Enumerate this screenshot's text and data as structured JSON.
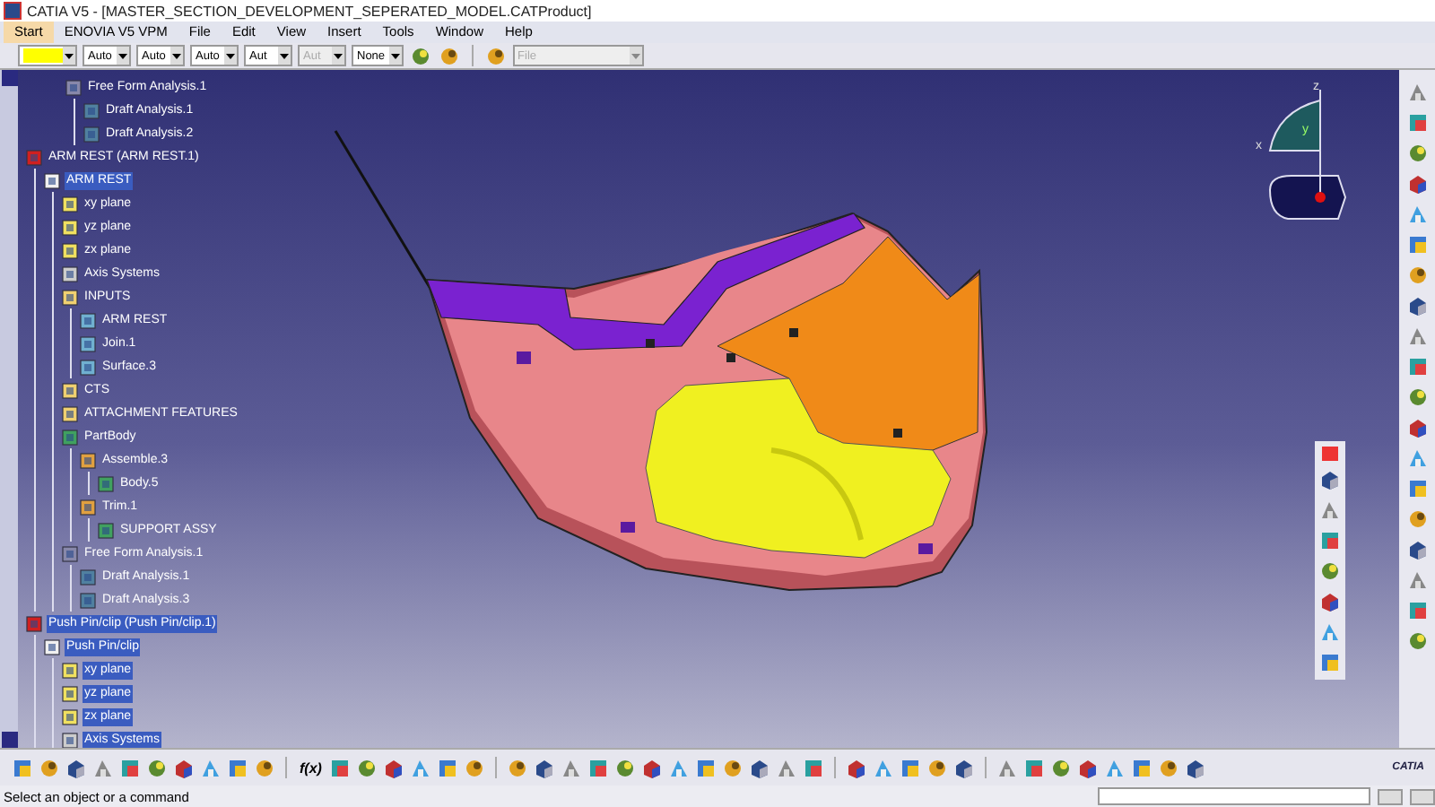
{
  "window": {
    "title": "CATIA V5 - [MASTER_SECTION_DEVELOPMENT_SEPERATED_MODEL.CATProduct]"
  },
  "menu": [
    {
      "label": "Start",
      "selected": true
    },
    {
      "label": "ENOVIA V5 VPM",
      "selected": false
    },
    {
      "label": "File",
      "selected": false
    },
    {
      "label": "Edit",
      "selected": false
    },
    {
      "label": "View",
      "selected": false
    },
    {
      "label": "Insert",
      "selected": false
    },
    {
      "label": "Tools",
      "selected": false
    },
    {
      "label": "Window",
      "selected": false
    },
    {
      "label": "Help",
      "selected": false
    }
  ],
  "format_toolbar": [
    {
      "kind": "color",
      "color": "#ffff00",
      "disabled": false
    },
    {
      "kind": "dropdown",
      "value": "Auto",
      "disabled": false
    },
    {
      "kind": "dropdown",
      "value": "Auto",
      "disabled": false
    },
    {
      "kind": "dropdown",
      "value": "Auto",
      "disabled": false
    },
    {
      "kind": "dropdown",
      "value": "Aut",
      "disabled": false
    },
    {
      "kind": "dropdown",
      "value": "Aut",
      "disabled": true
    },
    {
      "kind": "dropdown",
      "value": "None",
      "disabled": false
    }
  ],
  "file_toolbar": {
    "value": "File",
    "disabled": true
  },
  "tree": {
    "continued": [
      {
        "label": "Free Form Analysis.1",
        "kind": "analysis",
        "selected": false,
        "children": [
          {
            "label": "Draft Analysis.1",
            "kind": "draft",
            "selected": false
          },
          {
            "label": "Draft Analysis.2",
            "kind": "draft",
            "selected": false
          }
        ]
      }
    ],
    "items": [
      {
        "label": "ARM REST (ARM REST.1)",
        "kind": "product",
        "selected": false,
        "children": [
          {
            "label": "ARM REST",
            "kind": "part",
            "selected": true,
            "children": [
              {
                "label": "xy plane",
                "kind": "plane",
                "selected": false
              },
              {
                "label": "yz plane",
                "kind": "plane",
                "selected": false
              },
              {
                "label": "zx plane",
                "kind": "plane",
                "selected": false
              },
              {
                "label": "Axis Systems",
                "kind": "axis",
                "selected": false
              },
              {
                "label": "INPUTS",
                "kind": "geoset",
                "selected": false,
                "children": [
                  {
                    "label": "ARM REST",
                    "kind": "surface",
                    "selected": false
                  },
                  {
                    "label": "Join.1",
                    "kind": "surface",
                    "selected": false
                  },
                  {
                    "label": "Surface.3",
                    "kind": "surface",
                    "selected": false
                  }
                ]
              },
              {
                "label": "CTS",
                "kind": "geoset",
                "selected": false
              },
              {
                "label": "ATTACHMENT FEATURES",
                "kind": "geoset",
                "selected": false
              },
              {
                "label": "PartBody",
                "kind": "body",
                "selected": false,
                "children": [
                  {
                    "label": "Assemble.3",
                    "kind": "operation",
                    "selected": false,
                    "children": [
                      {
                        "label": "Body.5",
                        "kind": "body",
                        "selected": false
                      }
                    ]
                  },
                  {
                    "label": "Trim.1",
                    "kind": "operation",
                    "selected": false,
                    "children": [
                      {
                        "label": "SUPPORT ASSY",
                        "kind": "body",
                        "selected": false
                      }
                    ]
                  }
                ]
              },
              {
                "label": "Free Form Analysis.1",
                "kind": "analysis",
                "selected": false,
                "children": [
                  {
                    "label": "Draft Analysis.1",
                    "kind": "draft",
                    "selected": false
                  },
                  {
                    "label": "Draft Analysis.3",
                    "kind": "draft",
                    "selected": false
                  }
                ]
              }
            ]
          }
        ]
      },
      {
        "label": "Push Pin/clip (Push Pin/clip.1)",
        "kind": "product",
        "selected": true,
        "children": [
          {
            "label": "Push Pin/clip",
            "kind": "part",
            "selected": true,
            "children": [
              {
                "label": "xy plane",
                "kind": "plane",
                "selected": true
              },
              {
                "label": "yz plane",
                "kind": "plane",
                "selected": true
              },
              {
                "label": "zx plane",
                "kind": "plane",
                "selected": true
              },
              {
                "label": "Axis Systems",
                "kind": "axis",
                "selected": true
              }
            ]
          }
        ]
      }
    ]
  },
  "compass": {
    "axes": [
      "x",
      "y",
      "z"
    ]
  },
  "bottom_toolbar": {
    "formula_text": "f(x)"
  },
  "logo": {
    "text": "CATIA"
  },
  "status_bar": {
    "prompt": "Select an object or a command"
  }
}
